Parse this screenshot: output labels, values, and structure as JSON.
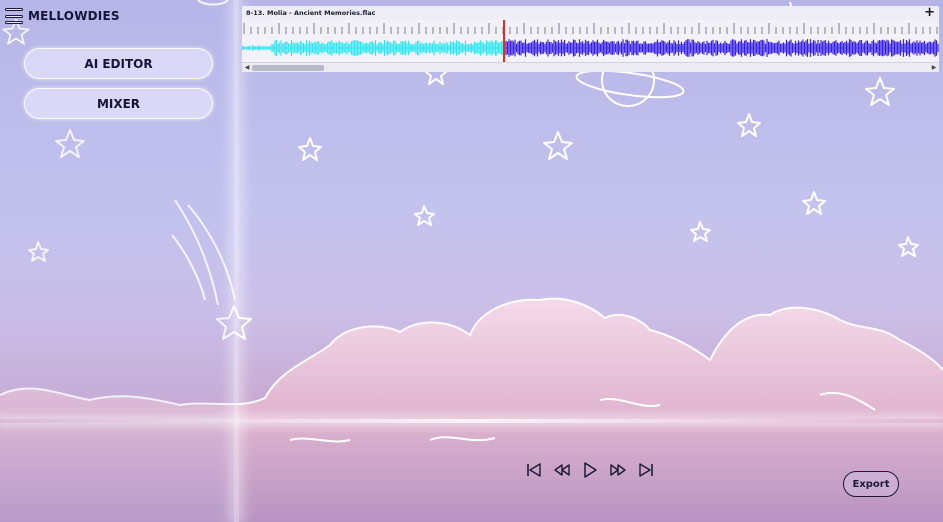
{
  "app": {
    "title": "MELLOWDIES"
  },
  "sidebar": {
    "items": [
      {
        "label": "AI EDITOR"
      },
      {
        "label": "MIXER"
      }
    ]
  },
  "track": {
    "filename": "8-13. Molia - Ancient Memories.flac",
    "add_label": "+",
    "played_color": "#34e6f0",
    "unplayed_color": "#3a1fe6",
    "playhead_color": "#e02a2a",
    "playhead_progress": 0.375
  },
  "transport": {
    "icons": [
      "skip-back-icon",
      "rewind-icon",
      "play-icon",
      "fast-forward-icon",
      "skip-forward-icon"
    ]
  },
  "export": {
    "label": "Export"
  },
  "colors": {
    "ink": "#16143a",
    "button_fill": "#e2e0fa"
  }
}
